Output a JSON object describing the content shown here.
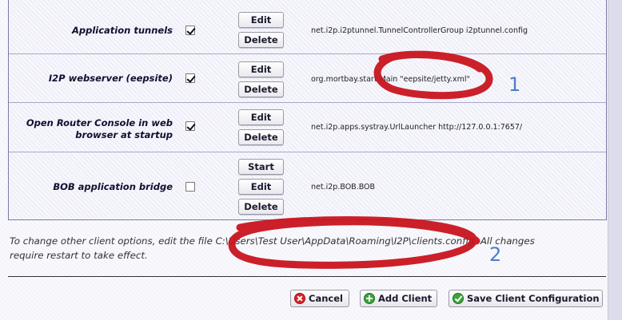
{
  "table": {
    "rows": [
      {
        "label": "Application tunnels",
        "enabled": true,
        "buttons": [
          "Edit",
          "Delete"
        ],
        "command": "net.i2p.i2ptunnel.TunnelControllerGroup i2ptunnel.config"
      },
      {
        "label": "I2P webserver (eepsite)",
        "enabled": true,
        "buttons": [
          "Edit",
          "Delete"
        ],
        "command": "org.mortbay.start.Main \"eepsite/jetty.xml\""
      },
      {
        "label_lines": [
          "Open Router Console in web",
          "browser at startup"
        ],
        "enabled": true,
        "buttons": [
          "Edit",
          "Delete"
        ],
        "command": "net.i2p.apps.systray.UrlLauncher http://127.0.0.1:7657/"
      },
      {
        "label": "BOB application bridge",
        "enabled": false,
        "buttons": [
          "Start",
          "Edit",
          "Delete"
        ],
        "command": "net.i2p.BOB.BOB"
      }
    ]
  },
  "note": {
    "line1": "To change other client options, edit the file C:\\Users\\Test User\\AppData\\Roaming\\I2P\\clients.config. All changes",
    "line2": "require restart to take effect."
  },
  "actions": {
    "cancel_label": "Cancel",
    "add_label": "Add Client",
    "save_label": "Save Client Configuration"
  },
  "annotations": {
    "marker1": "1",
    "marker2": "2"
  },
  "colors": {
    "highlight": "#c8141e",
    "annotation_text": "#4a7fc6",
    "table_border": "#7a7aa6"
  }
}
